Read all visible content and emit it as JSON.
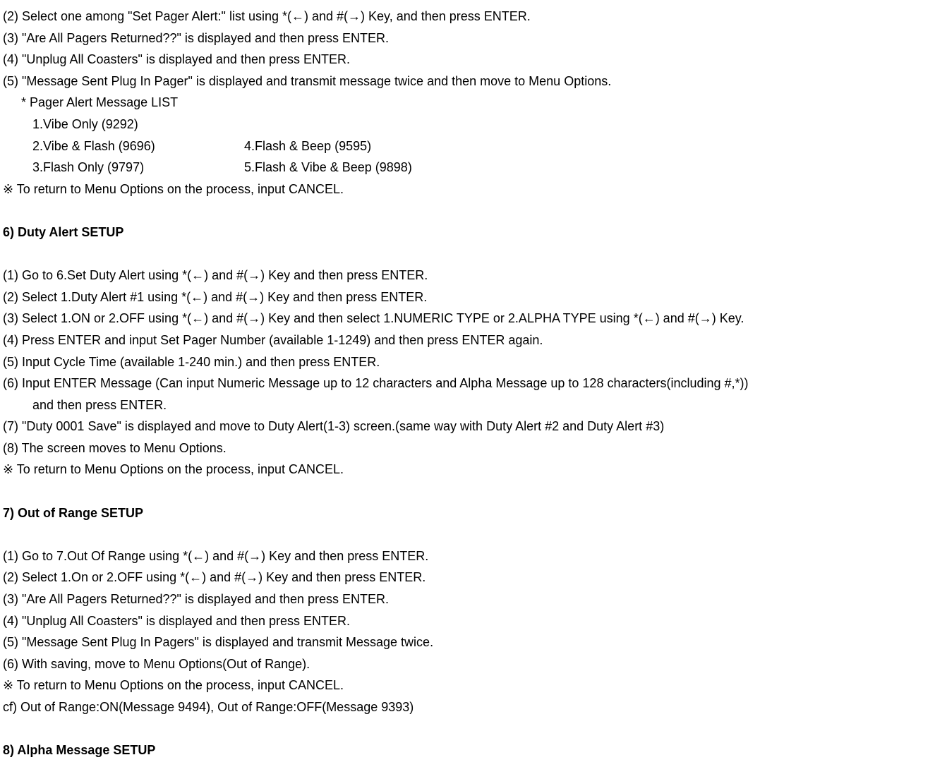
{
  "section5": {
    "l2": "(2) Select one among \"Set Pager Alert:\" list using *(←) and #(→) Key, and then press ENTER.",
    "l3": "(3) \"Are All Pagers Returned??\" is displayed and then press ENTER.",
    "l4": "(4) \"Unplug All Coasters\" is displayed and then press ENTER.",
    "l5": "(5) \"Message Sent Plug In Pager\" is displayed and transmit message twice and then move to Menu Options.",
    "listHeader": "* Pager Alert Message LIST",
    "item1": "1.Vibe Only (9292)",
    "item2": "2.Vibe & Flash (9696)",
    "item4": "4.Flash & Beep (9595)",
    "item3": "3.Flash Only (9797)",
    "item5": "5.Flash & Vibe & Beep (9898)",
    "note": "※ To return to Menu Options on the process, input CANCEL."
  },
  "section6": {
    "heading": "6) Duty Alert SETUP",
    "l1": "(1) Go to 6.Set Duty Alert using *(←) and #(→) Key and then press ENTER.",
    "l2": "(2) Select 1.Duty Alert #1 using *(←) and #(→) Key and then press ENTER.",
    "l3": "(3) Select 1.ON or 2.OFF using *(←) and #(→) Key and then select 1.NUMERIC TYPE or 2.ALPHA TYPE using *(←) and #(→) Key.",
    "l4": "(4) Press ENTER and input Set Pager Number (available 1-1249) and then press ENTER again.",
    "l5": "(5) Input Cycle Time (available 1-240 min.) and then press ENTER.",
    "l6a": "(6) Input ENTER Message (Can input Numeric Message up to 12 characters and Alpha Message up to 128 characters(including #,*))",
    "l6b": "and then press ENTER.",
    "l7": "(7) \"Duty 0001 Save\" is displayed and move to Duty Alert(1-3) screen.(same way with Duty Alert #2 and Duty Alert #3)",
    "l8": "(8) The screen moves to Menu Options.",
    "note": "※ To return to Menu Options on the process, input CANCEL."
  },
  "section7": {
    "heading": "7) Out of Range SETUP",
    "l1": "(1) Go to 7.Out Of Range using *(←) and #(→) Key and then press ENTER.",
    "l2": "(2) Select 1.On or 2.OFF using *(←) and #(→) Key and then press ENTER.",
    "l3": "(3) \"Are All Pagers Returned??\" is displayed and then press ENTER.",
    "l4": "(4) \"Unplug All Coasters\" is displayed and then press ENTER.",
    "l5": "(5) \"Message Sent Plug In Pagers\" is displayed and transmit Message twice.",
    "l6": "(6) With saving, move to Menu Options(Out of Range).",
    "note": "※ To return to Menu Options on the process, input CANCEL.",
    "cf": "cf) Out of Range:ON(Message 9494), Out of Range:OFF(Message 9393)"
  },
  "section8": {
    "heading": "8) Alpha Message SETUP"
  }
}
